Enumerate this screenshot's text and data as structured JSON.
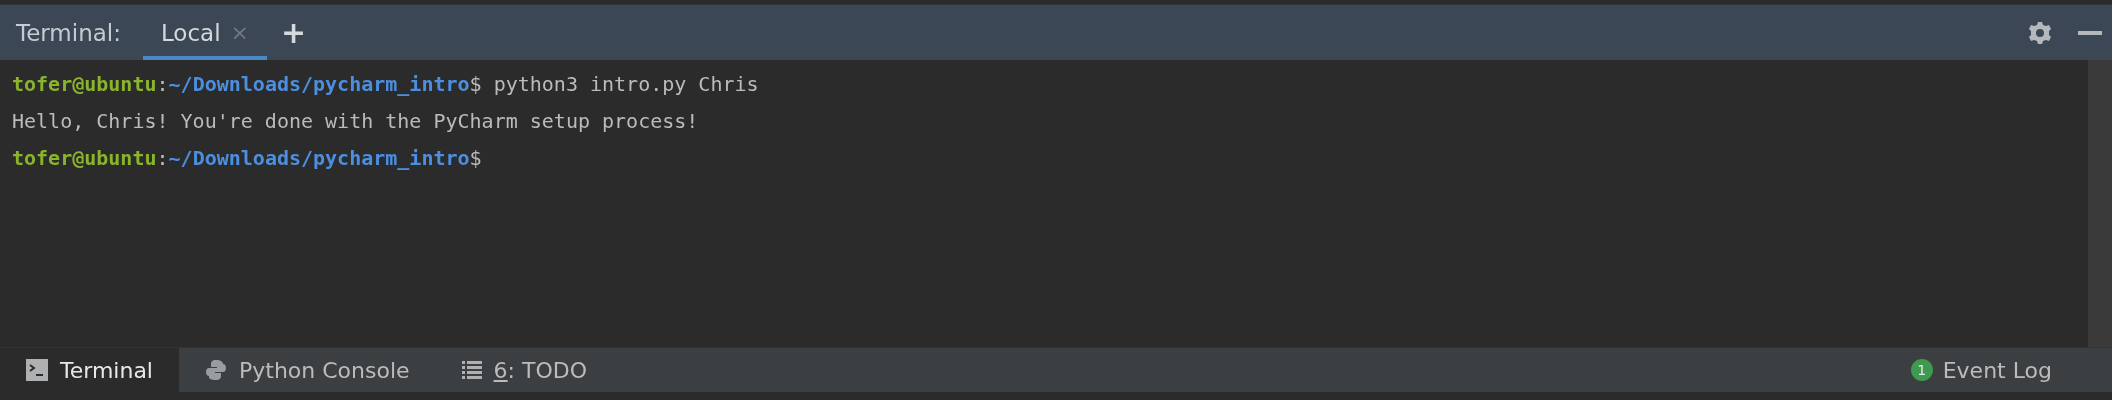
{
  "header": {
    "title": "Terminal:",
    "tabs": [
      {
        "label": "Local",
        "close": "×",
        "selected": true
      }
    ],
    "add": "+"
  },
  "lines": [
    {
      "kind": "prompt",
      "user": "tofer@ubuntu",
      "sep": ":",
      "path": "~/Downloads/pycharm_intro",
      "sign": "$",
      "command": " python3 intro.py Chris"
    },
    {
      "kind": "output",
      "text": "Hello, Chris! You're done with the PyCharm setup process!"
    },
    {
      "kind": "prompt",
      "user": "tofer@ubuntu",
      "sep": ":",
      "path": "~/Downloads/pycharm_intro",
      "sign": "$"
    }
  ],
  "tool_tabs": [
    {
      "kind": "terminal",
      "label": "Terminal",
      "selected": true
    },
    {
      "kind": "python",
      "label": "Python Console",
      "selected": false
    },
    {
      "kind": "todo",
      "mnemonic": "6",
      "label": ": TODO",
      "selected": false
    }
  ],
  "event_log": {
    "count": "1",
    "label": "Event Log"
  }
}
